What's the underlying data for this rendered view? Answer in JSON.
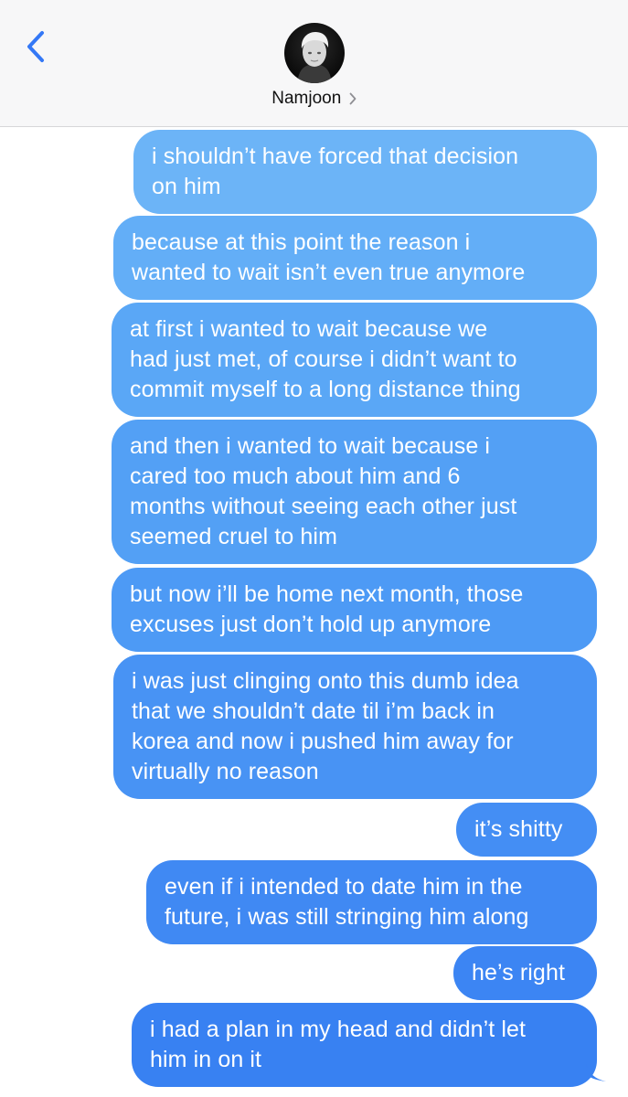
{
  "header": {
    "contact_name": "Namjoon",
    "back_icon": "chevron-left-icon",
    "detail_icon": "chevron-right-icon",
    "accent_color": "#3478f6"
  },
  "messages": [
    {
      "lines": [
        "i shouldn’t have forced that decision",
        "on him"
      ]
    },
    {
      "lines": [
        "because at this point the reason i",
        "wanted to wait isn’t even true anymore"
      ]
    },
    {
      "lines": [
        "at first i wanted to wait because we",
        "had just met, of course i didn’t want to",
        "commit myself to a long distance thing"
      ]
    },
    {
      "lines": [
        "and then i wanted to wait because i",
        "cared too much about him and 6",
        "months without seeing each other just",
        "seemed cruel to him"
      ]
    },
    {
      "lines": [
        "but now i’ll be home next month, those",
        "excuses just don’t hold up anymore"
      ]
    },
    {
      "lines": [
        "i was just clinging onto this dumb idea",
        "that we shouldn’t date til i’m back in",
        "korea and now i pushed him away for",
        "virtually no reason"
      ]
    },
    {
      "lines": [
        "it’s shitty"
      ]
    },
    {
      "lines": [
        "even if i intended to date him in the",
        "future, i was still stringing him along"
      ]
    },
    {
      "lines": [
        "he’s right"
      ]
    },
    {
      "lines": [
        "i had a plan in my head and didn’t let",
        "him in on it"
      ]
    }
  ]
}
